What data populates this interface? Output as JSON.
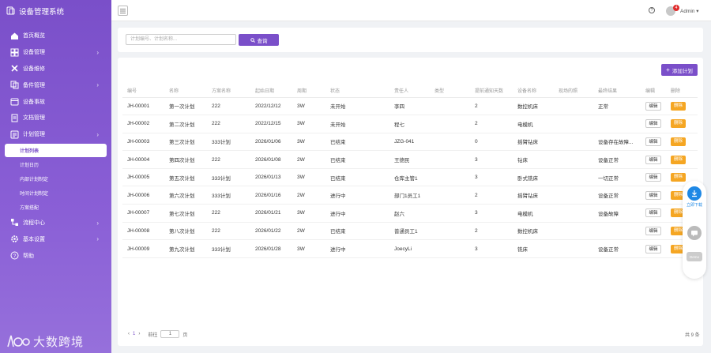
{
  "app": {
    "title": "设备管理系统"
  },
  "sidebar": {
    "items": [
      {
        "label": "首页概览",
        "icon": "home-icon",
        "chevron": false
      },
      {
        "label": "设备管理",
        "icon": "grid-icon",
        "chevron": true
      },
      {
        "label": "设备维修",
        "icon": "tools-icon",
        "chevron": false
      },
      {
        "label": "备件管理",
        "icon": "copy-icon",
        "chevron": true
      },
      {
        "label": "设备事故",
        "icon": "calendar-icon",
        "chevron": false
      },
      {
        "label": "文档管理",
        "icon": "document-icon",
        "chevron": false
      },
      {
        "label": "计划管理",
        "icon": "list-icon",
        "chevron": true
      }
    ],
    "sub_items": [
      "计划列表",
      "计划日历",
      "内部计划制定",
      "时间计划制定",
      "方案搭配"
    ],
    "items_after": [
      {
        "label": "流程中心",
        "icon": "flow-icon",
        "chevron": true
      },
      {
        "label": "基本设置",
        "icon": "gear-icon",
        "chevron": true
      },
      {
        "label": "帮助",
        "icon": "help-icon",
        "chevron": false
      }
    ],
    "footer_brand": "大数跨境"
  },
  "topbar": {
    "user": "Admin",
    "notification_count": "4"
  },
  "search": {
    "placeholder": "计划编号、计划名称...",
    "button_label": "查询"
  },
  "toolbar": {
    "add_label": "添加计划"
  },
  "table": {
    "columns": [
      "编号",
      "名称",
      "方案名称",
      "起始日期",
      "周期",
      "状态",
      "责任人",
      "类型",
      "提前通知天数",
      "设备名称",
      "现场的照",
      "最终结果",
      "编辑",
      "删除"
    ],
    "edit_label": "编辑",
    "delete_label": "删除",
    "rows": [
      [
        "JH-00001",
        "第一次计划",
        "222",
        "2022/12/12",
        "3W",
        "未开始",
        "李四",
        "",
        "2",
        "数控机床",
        "",
        "正常"
      ],
      [
        "JH-00002",
        "第二次计划",
        "222",
        "2022/12/15",
        "3W",
        "未开始",
        "程七",
        "",
        "2",
        "电模机",
        "",
        ""
      ],
      [
        "JH-00003",
        "第三次计划",
        "333计划",
        "2026/01/06",
        "3W",
        "已结束",
        "JZG-041",
        "",
        "0",
        "摇臂钻床",
        "",
        "设备存在故障..."
      ],
      [
        "JH-00004",
        "第四次计划",
        "222",
        "2026/01/08",
        "2W",
        "已结束",
        "王德民",
        "",
        "3",
        "钻床",
        "",
        "设备正常"
      ],
      [
        "JH-00005",
        "第五次计划",
        "333计划",
        "2026/01/13",
        "3W",
        "已结束",
        "仓库主管1",
        "",
        "3",
        "卧式铣床",
        "",
        "一切正常"
      ],
      [
        "JH-00006",
        "第六次计划",
        "333计划",
        "2026/01/16",
        "2W",
        "进行中",
        "部门1员工1",
        "",
        "2",
        "摇臂钻床",
        "",
        "设备正常"
      ],
      [
        "JH-00007",
        "第七次计划",
        "222",
        "2026/01/21",
        "3W",
        "进行中",
        "赵六",
        "",
        "3",
        "电模机",
        "",
        "设备故障"
      ],
      [
        "JH-00008",
        "第八次计划",
        "222",
        "2026/01/22",
        "2W",
        "已结束",
        "普通员工1",
        "",
        "2",
        "数控机床",
        "",
        ""
      ],
      [
        "JH-00009",
        "第九次计划",
        "333计划",
        "2026/01/28",
        "3W",
        "进行中",
        "JoecyLi",
        "",
        "3",
        "铣床",
        "",
        "设备正常"
      ]
    ]
  },
  "pagination": {
    "current_page": "1",
    "goto_label": "前往",
    "goto_value": "1",
    "page_unit": "页",
    "total_text": "共 9 条"
  },
  "float_tool": {
    "download_label": "立即下载",
    "demo_label": "Demo"
  },
  "colors": {
    "accent": "#7a4fc9",
    "delete": "#f5a623",
    "badge": "#e02b2b",
    "download": "#1e88e5"
  }
}
